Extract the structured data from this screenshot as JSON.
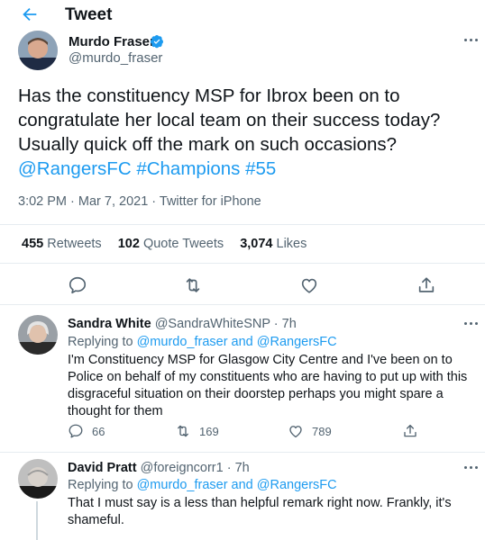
{
  "header": {
    "title": "Tweet",
    "icons": [
      "back-arrow-icon"
    ]
  },
  "main_tweet": {
    "author_name": "Murdo Fraser",
    "author_handle": "@murdo_fraser",
    "text_plain": "Has the constituency MSP for Ibrox been on to congratulate her local team on their success today? Usually quick off the mark on such occasions?",
    "hashtag_1": "@RangersFC",
    "hashtag_2": "#Champions",
    "hashtag_3": "#55",
    "timestamp": "3:02 PM · Mar 7, 2021 · Twitter for iPhone",
    "retweets_count": "455",
    "retweets_label": "Retweets",
    "quotes_count": "102",
    "quotes_label": "Quote Tweets",
    "likes_count": "3,074",
    "likes_label": "Likes"
  },
  "replies": [
    {
      "name": "Sandra White",
      "handle_time": "@SandraWhiteSNP · 7h",
      "replying_prefix": "Replying to",
      "replying_to": "@murdo_fraser and @RangersFC",
      "text": "I'm Constituency MSP for Glasgow City Centre and I've been on to Police on behalf of my constituents who are having to put up with this disgraceful situation on their doorstep perhaps you might spare a thought for them",
      "reply_count": "66",
      "retweet_count": "169",
      "like_count": "789"
    },
    {
      "name": "David Pratt",
      "handle_time": "@foreigncorr1 · 7h",
      "replying_prefix": "Replying to",
      "replying_to": "@murdo_fraser and @RangersFC",
      "text": "That I must say is a less than helpful remark right now. Frankly, it's shameful."
    }
  ],
  "colors": {
    "accent": "#1d9bf0",
    "text": "#0f1419",
    "muted": "#536471",
    "divider": "#e6ecf0"
  }
}
